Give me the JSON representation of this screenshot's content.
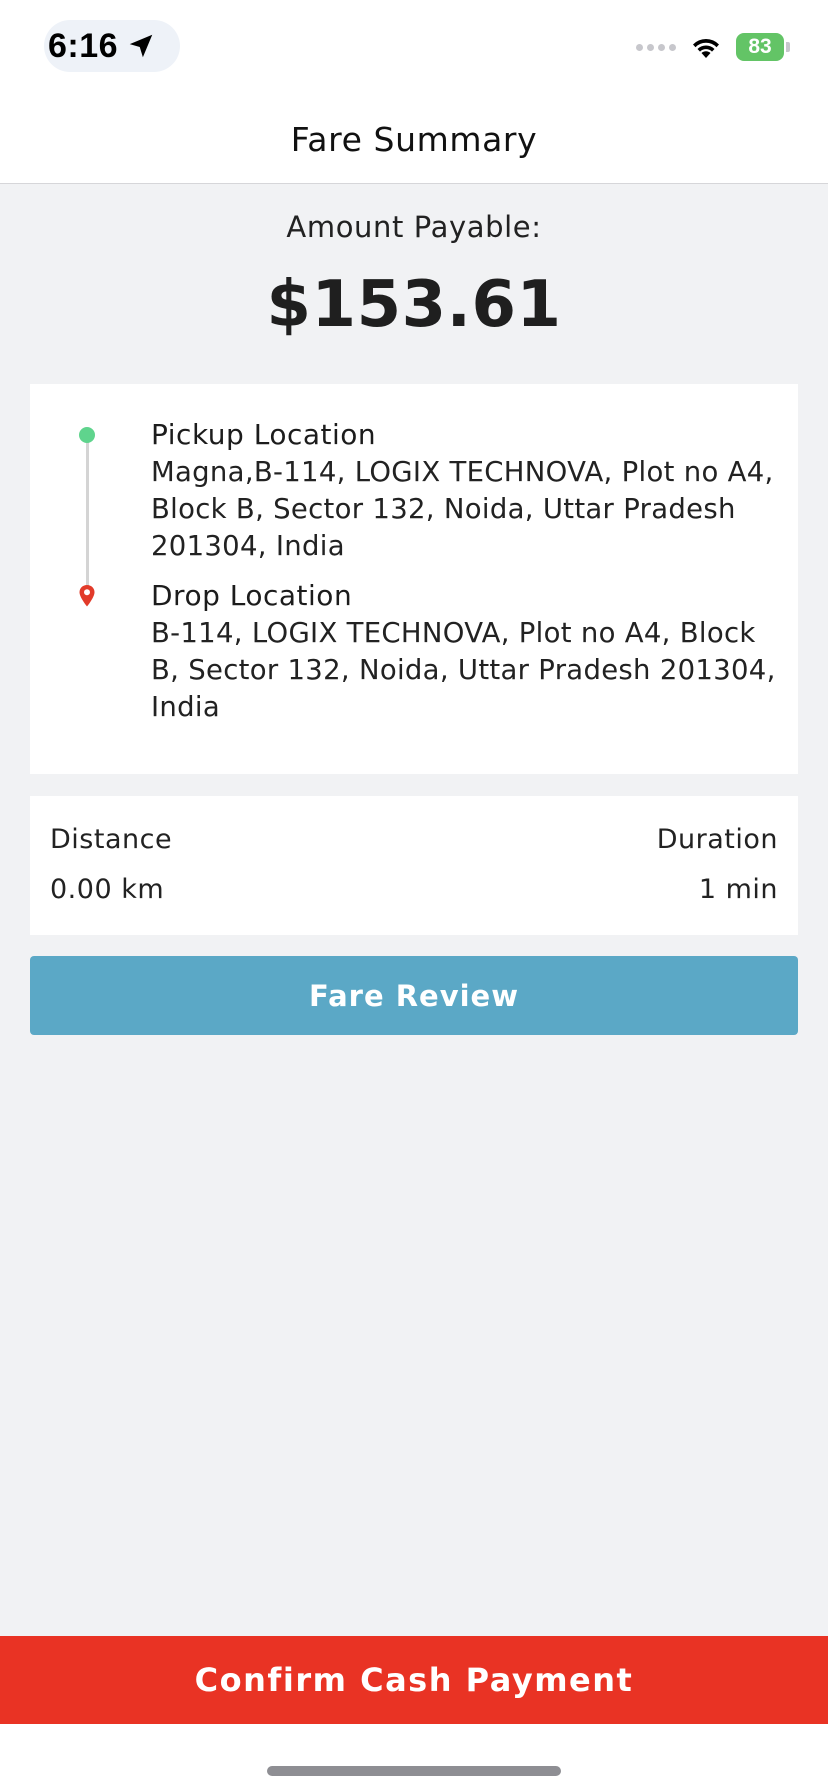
{
  "status_bar": {
    "time": "6:16",
    "battery_level": "83",
    "icons": [
      "location-arrow-icon",
      "signal-dots-icon",
      "wifi-icon",
      "battery-charging-icon"
    ],
    "battery_color": "#63c466"
  },
  "header": {
    "title": "Fare Summary"
  },
  "amount": {
    "label": "Amount Payable:",
    "value": "$153.61"
  },
  "route": {
    "pickup": {
      "title": "Pickup Location",
      "address": "Magna,B-114, LOGIX TECHNOVA, Plot no A4, Block B, Sector 132, Noida, Uttar Pradesh 201304, India",
      "marker_color": "#5fd48d"
    },
    "drop": {
      "title": "Drop Location",
      "address": "B-114, LOGIX TECHNOVA, Plot no A4, Block B, Sector 132, Noida, Uttar Pradesh 201304, India",
      "marker_color": "#e23b2a"
    }
  },
  "trip_stats": {
    "distance_label": "Distance",
    "distance_value": "0.00 km",
    "duration_label": "Duration",
    "duration_value": "1 min"
  },
  "actions": {
    "fare_review_label": "Fare Review",
    "confirm_label": "Confirm Cash Payment"
  },
  "colors": {
    "background": "#f1f2f4",
    "fare_review_button": "#5ba8c6",
    "confirm_button": "#e93324"
  }
}
